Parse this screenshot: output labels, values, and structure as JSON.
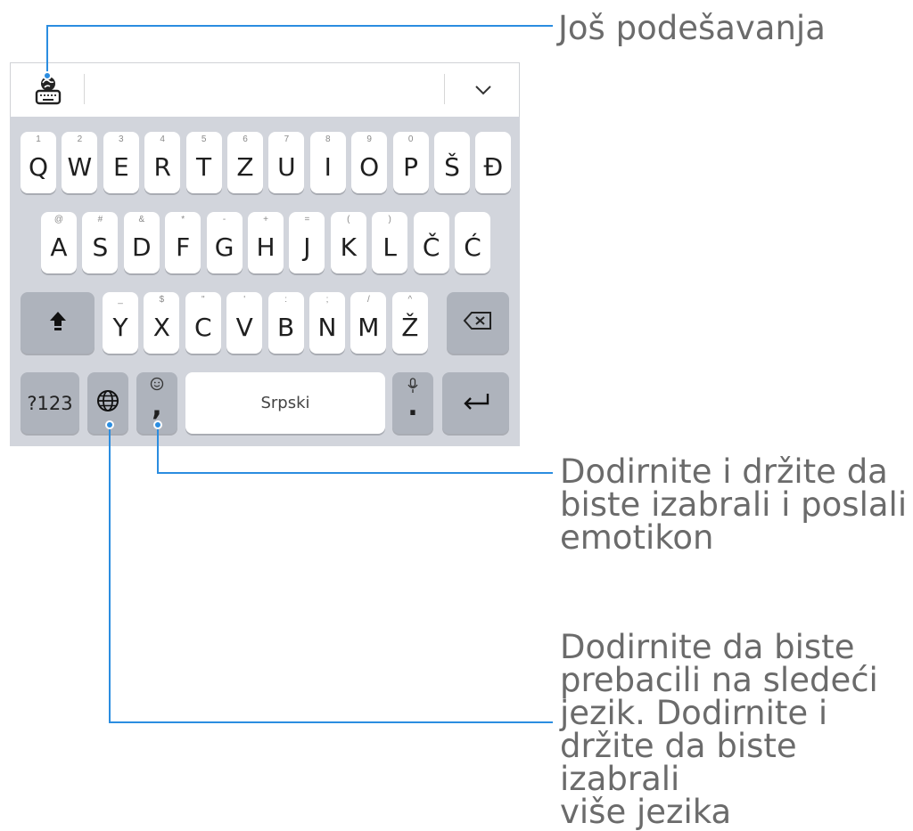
{
  "keyboard": {
    "toolbar": {
      "settings_icon": "globe-keyboard-icon",
      "collapse_icon": "chevron-down-icon"
    },
    "row1": [
      {
        "label": "Q",
        "hint": "1"
      },
      {
        "label": "W",
        "hint": "2"
      },
      {
        "label": "E",
        "hint": "3"
      },
      {
        "label": "R",
        "hint": "4"
      },
      {
        "label": "T",
        "hint": "5"
      },
      {
        "label": "Z",
        "hint": "6"
      },
      {
        "label": "U",
        "hint": "7"
      },
      {
        "label": "I",
        "hint": "8"
      },
      {
        "label": "O",
        "hint": "9"
      },
      {
        "label": "P",
        "hint": "0"
      },
      {
        "label": "Š",
        "hint": ""
      },
      {
        "label": "Đ",
        "hint": ""
      }
    ],
    "row2": [
      {
        "label": "A",
        "hint": "@"
      },
      {
        "label": "S",
        "hint": "#"
      },
      {
        "label": "D",
        "hint": "&"
      },
      {
        "label": "F",
        "hint": "*"
      },
      {
        "label": "G",
        "hint": "-"
      },
      {
        "label": "H",
        "hint": "+"
      },
      {
        "label": "J",
        "hint": "="
      },
      {
        "label": "K",
        "hint": "("
      },
      {
        "label": "L",
        "hint": ")"
      },
      {
        "label": "Č",
        "hint": ""
      },
      {
        "label": "Ć",
        "hint": ""
      }
    ],
    "row3": [
      {
        "label": "Y",
        "hint": "_"
      },
      {
        "label": "X",
        "hint": "$"
      },
      {
        "label": "C",
        "hint": "\""
      },
      {
        "label": "V",
        "hint": "'"
      },
      {
        "label": "B",
        "hint": ":"
      },
      {
        "label": "N",
        "hint": ";"
      },
      {
        "label": "M",
        "hint": "/"
      },
      {
        "label": "Ž",
        "hint": "^"
      }
    ],
    "shift_icon": "shift-arrow-icon",
    "backspace_icon": "backspace-icon",
    "bottom": {
      "symbols_label": "?123",
      "globe_icon": "globe-icon",
      "comma_label": ",",
      "comma_hint_icon": "smiley-icon",
      "space_label": "Srpski",
      "period_label": ".",
      "period_hint_icon": "microphone-icon",
      "enter_icon": "enter-arrow-icon"
    }
  },
  "annotations": {
    "more_settings": "Još podešavanja",
    "emoji_lines": [
      "Dodirnite i držite da",
      "biste izabrali i poslali",
      "emotikon"
    ],
    "language_lines": [
      "Dodirnite da biste",
      "prebacili na sledeći",
      "jezik. Dodirnite i",
      "držite da biste izabrali",
      "više jezika"
    ]
  },
  "colors": {
    "callout_line": "#2b8de0",
    "keyboard_bg": "#d2d5dc",
    "dark_key": "#aeb3bc",
    "annotation_text": "#6b6b6b"
  }
}
